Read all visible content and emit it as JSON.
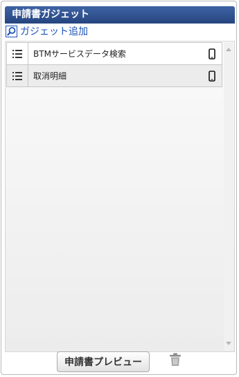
{
  "panel": {
    "title": "申請書ガジェット",
    "add_gadget_label": "ガジェット追加"
  },
  "list": {
    "items": [
      {
        "label": "BTMサービスデータ検索",
        "icon": "mobile-icon"
      },
      {
        "label": "取消明細",
        "icon": "mobile-icon"
      }
    ]
  },
  "footer": {
    "preview_label": "申請書プレビュー",
    "trash_icon": "trash-icon"
  },
  "colors": {
    "header_bg": "#2c4a85",
    "link": "#1a52b5"
  }
}
